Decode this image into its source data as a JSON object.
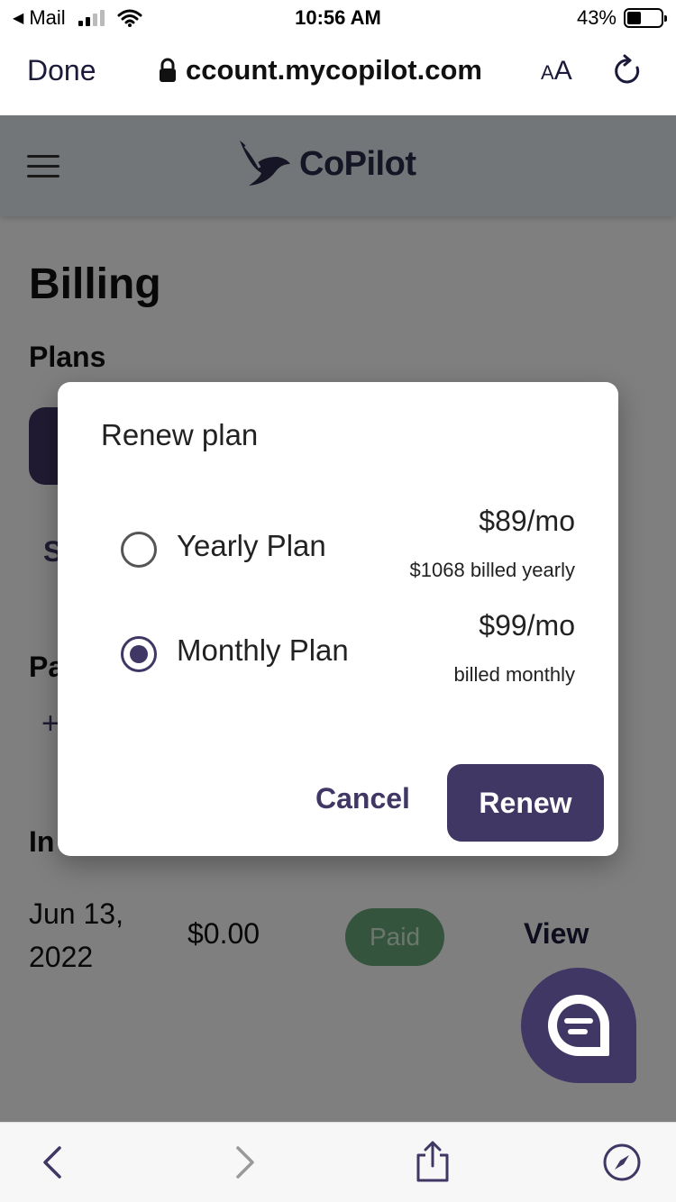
{
  "status_bar": {
    "back_app": "Mail",
    "time": "10:56 AM",
    "battery": "43%",
    "battery_level": 0.43
  },
  "browser": {
    "done_label": "Done",
    "url": "ccount.mycopilot.com",
    "aa_label_small": "A",
    "aa_label_large": "A"
  },
  "site": {
    "logo_text": "CoPilot"
  },
  "page": {
    "title": "Billing",
    "plans_heading": "Plans",
    "partial_s": "S",
    "partial_pa": "Pa",
    "partial_plus": "+",
    "partial_in": "In",
    "invoice": {
      "date_line1": "Jun 13,",
      "date_line2": "2022",
      "amount": "$0.00",
      "status": "Paid",
      "view_label": "View"
    }
  },
  "modal": {
    "title": "Renew plan",
    "options": [
      {
        "label": "Yearly Plan",
        "price": "$89/mo",
        "sub": "$1068 billed yearly",
        "selected": false
      },
      {
        "label": "Monthly Plan",
        "price": "$99/mo",
        "sub": "billed monthly",
        "selected": true
      }
    ],
    "cancel_label": "Cancel",
    "renew_label": "Renew"
  },
  "colors": {
    "brand": "#413764",
    "paid_badge": "#6aa87a"
  },
  "icons": {
    "toolbar": [
      "back-icon",
      "forward-icon",
      "share-icon",
      "compass-icon"
    ],
    "chat": "chat-icon"
  }
}
